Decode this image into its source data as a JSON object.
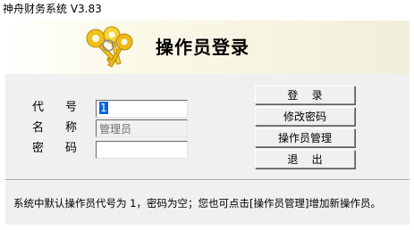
{
  "window": {
    "title": "神舟财务系统 V3.83"
  },
  "banner": {
    "heading": "操作员登录",
    "icon": "keys-icon",
    "key_color": "#f2c21a"
  },
  "form": {
    "code_label": {
      "a": "代",
      "b": "号"
    },
    "name_label": {
      "a": "名",
      "b": "称"
    },
    "password_label": {
      "a": "密",
      "b": "码"
    },
    "code_value": "1",
    "name_value": "管理员",
    "password_value": ""
  },
  "buttons": {
    "login": "登    录",
    "change_password": "修改密码",
    "operator_management": "操作员管理",
    "exit": "退    出"
  },
  "status": {
    "message": "系统中默认操作员代号为 1，密码为空；您也可点击[操作员管理]增加新操作员。"
  },
  "colors": {
    "selection": "#0a64d6",
    "dialog_bg": "#f0f0f0"
  }
}
